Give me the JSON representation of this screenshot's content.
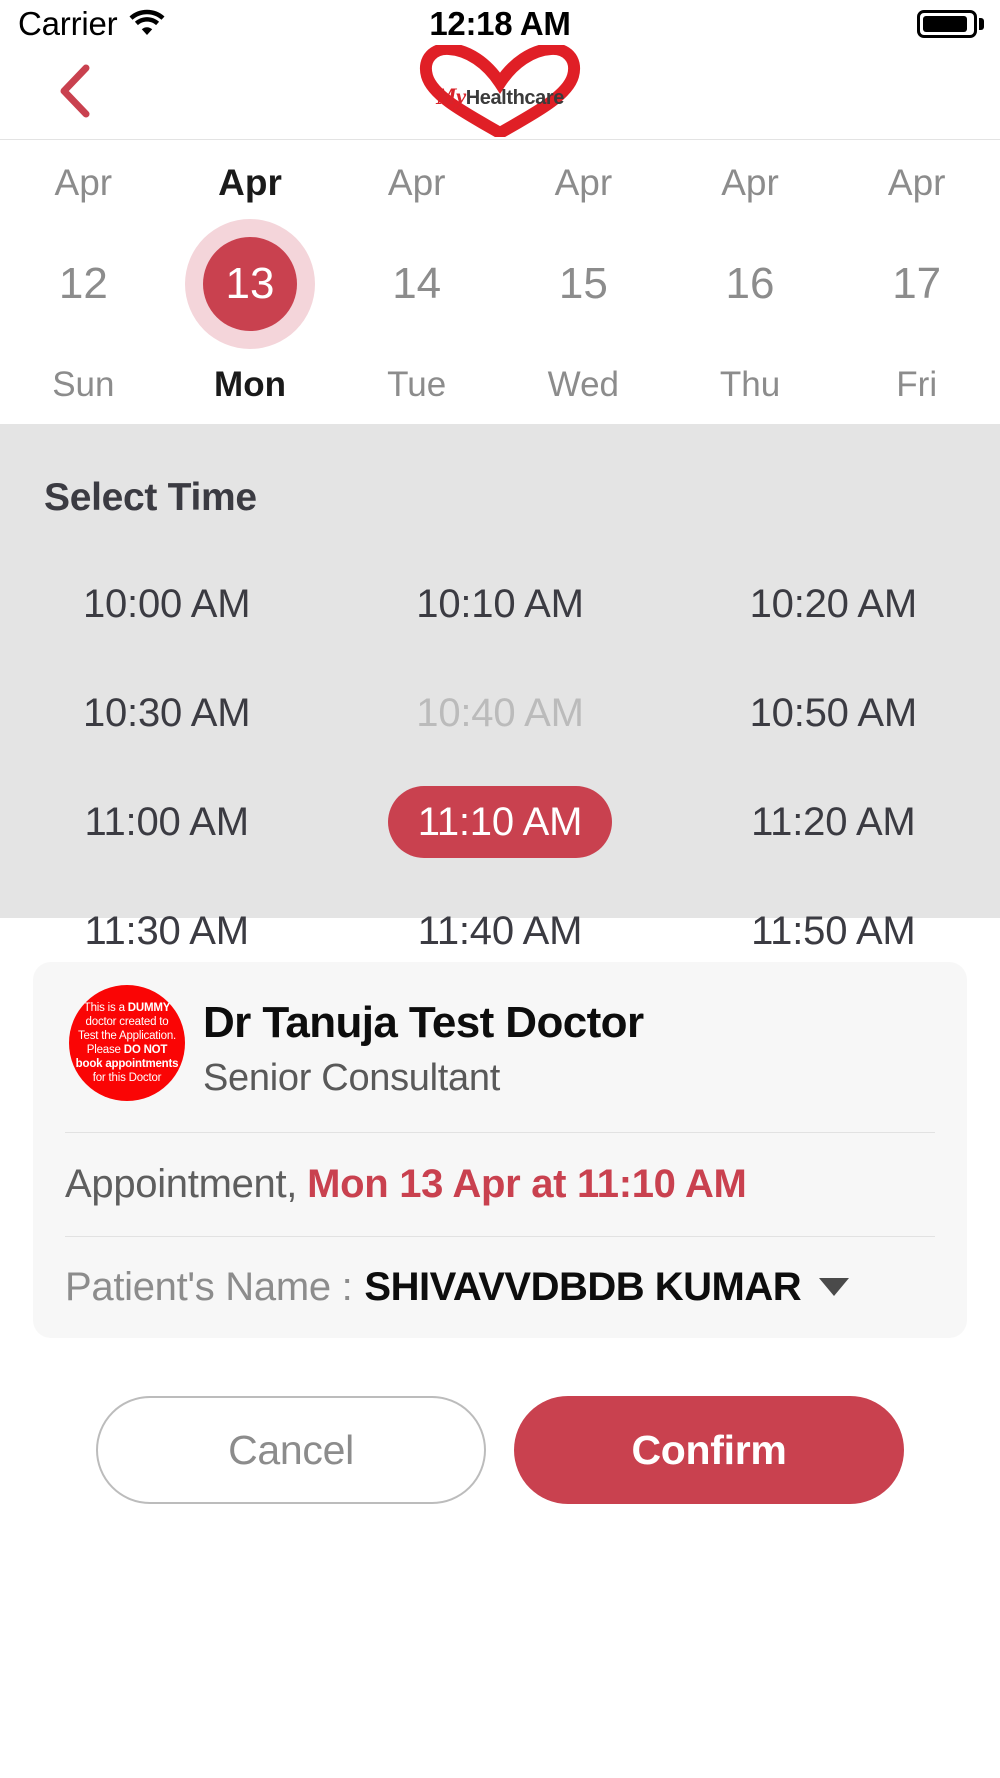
{
  "status_bar": {
    "carrier": "Carrier",
    "wifi_icon": "wifi-icon",
    "time": "12:18 AM",
    "battery_icon": "battery-full-icon"
  },
  "nav": {
    "back_icon": "chevron-left-icon",
    "logo": {
      "heart_icon": "heart-outline-icon",
      "brand_primary": "My",
      "brand_secondary": "Healthcare"
    }
  },
  "date_strip": {
    "days": [
      {
        "month": "Apr",
        "day_number": "12",
        "weekday": "Sun",
        "selected": false
      },
      {
        "month": "Apr",
        "day_number": "13",
        "weekday": "Mon",
        "selected": true
      },
      {
        "month": "Apr",
        "day_number": "14",
        "weekday": "Tue",
        "selected": false
      },
      {
        "month": "Apr",
        "day_number": "15",
        "weekday": "Wed",
        "selected": false
      },
      {
        "month": "Apr",
        "day_number": "16",
        "weekday": "Thu",
        "selected": false
      },
      {
        "month": "Apr",
        "day_number": "17",
        "weekday": "Fri",
        "selected": false
      }
    ]
  },
  "select_time": {
    "title": "Select Time",
    "slots": [
      {
        "label": "10:00 AM",
        "state": "available"
      },
      {
        "label": "10:10 AM",
        "state": "available"
      },
      {
        "label": "10:20 AM",
        "state": "available"
      },
      {
        "label": "10:30 AM",
        "state": "available"
      },
      {
        "label": "10:40 AM",
        "state": "disabled"
      },
      {
        "label": "10:50 AM",
        "state": "available"
      },
      {
        "label": "11:00 AM",
        "state": "available"
      },
      {
        "label": "11:10 AM",
        "state": "selected"
      },
      {
        "label": "11:20 AM",
        "state": "available"
      },
      {
        "label": "11:30 AM",
        "state": "available"
      },
      {
        "label": "11:40 AM",
        "state": "available"
      },
      {
        "label": "11:50 AM",
        "state": "available"
      }
    ]
  },
  "appointment_card": {
    "avatar": {
      "icon": "dummy-doctor-badge-icon",
      "line1_prefix": "This is a ",
      "line1_bold": "DUMMY",
      "line2": "doctor created to",
      "line3": "Test the Application.",
      "line4_prefix": "Please ",
      "line4_bold": "DO NOT",
      "line5_bold": "book appointments",
      "line6": "for this Doctor"
    },
    "doctor_name": "Dr Tanuja Test Doctor",
    "doctor_role": "Senior Consultant",
    "appointment_label": "Appointment,",
    "appointment_value": "Mon 13 Apr at 11:10 AM",
    "patient_label": "Patient's Name :",
    "patient_value": "SHIVAVVDBDB KUMAR",
    "patient_caret_icon": "chevron-down-icon"
  },
  "actions": {
    "cancel_label": "Cancel",
    "confirm_label": "Confirm"
  },
  "colors": {
    "accent": "#c9414f",
    "accent_halo": "#f4d5da",
    "logo_red": "#d8232a",
    "avatar_red": "#fa0505",
    "panel_bg": "#e4e4e4",
    "card_bg": "#f7f7f7",
    "muted_text": "#8c8c8c",
    "disabled_text": "#bbbbbb"
  }
}
